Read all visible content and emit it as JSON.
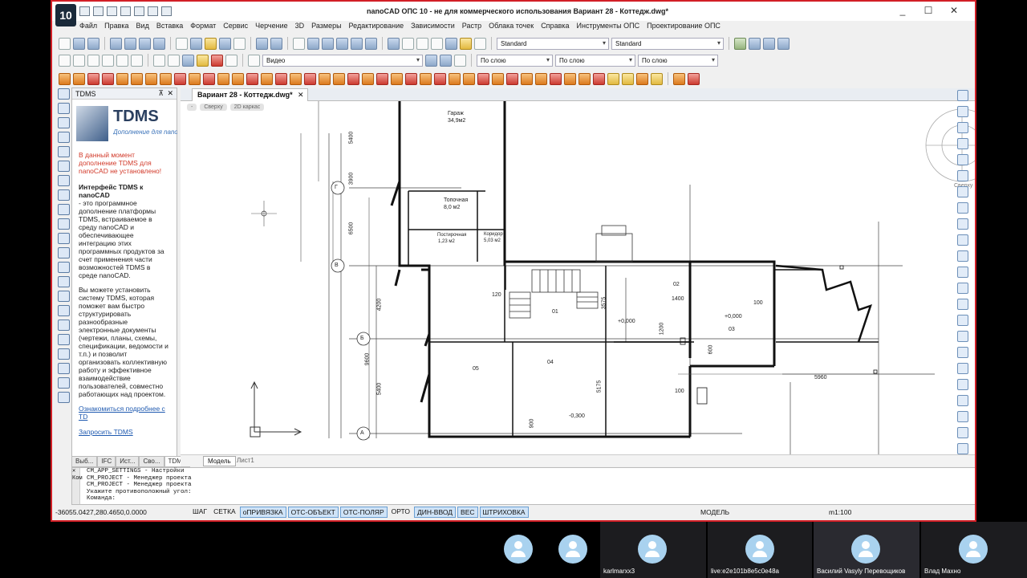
{
  "window": {
    "title": "nanoCAD ОПС 10 - не для коммерческого использования Вариант 28 - Коттедж.dwg*",
    "logo": "10",
    "controls": [
      "_",
      "☐",
      "✕"
    ]
  },
  "menu": [
    "Файл",
    "Правка",
    "Вид",
    "Вставка",
    "Формат",
    "Сервис",
    "Черчение",
    "3D",
    "Размеры",
    "Редактирование",
    "Зависимости",
    "Растр",
    "Облака точек",
    "Справка",
    "Инструменты ОПС",
    "Проектирование ОПС"
  ],
  "toolbar": {
    "text_style": "Standard",
    "dim_style": "Standard",
    "visual_style": "Видео",
    "color": "По слою",
    "linetype": "По слою",
    "lineweight": "По слою"
  },
  "tdms": {
    "panel_title": "TDMS",
    "logo_text": "TDMS",
    "logo_sub": "Дополнение для nano",
    "warning": "В данный момент дополнение TDMS для nanoCAD не установлено!",
    "intro_bold": "Интерфейс TDMS к nanoCAD",
    "intro": "- это программное дополнение платформы TDMS, встраиваемое в среду nanoCAD и обеспечивающее интеграцию этих программных продуктов за счет применения части возможностей TDMS в среде nanoCAD.",
    "body": "Вы можете установить систему TDMS, которая поможет вам быстро структурировать разнообразные электронные документы (чертежи, планы, схемы, спецификации, ведомости и т.п.) и позволит организовать коллективную работу и эффективное взаимодействие пользователей, совместно работающих над проектом.",
    "link_more": "Ознакомиться подробнее с TD",
    "link_request": "Запросить TDMS",
    "tabs": [
      "Выб...",
      "IFC",
      "Ист...",
      "Сво...",
      "TDMS"
    ]
  },
  "document": {
    "tab": "Вариант 28 - Коттедж.dwg*",
    "view_controls": [
      "-",
      "Сверху",
      "2D каркас"
    ],
    "layout_tabs": [
      "Модель",
      "Лист1"
    ],
    "viewcube_label": "Сверху"
  },
  "drawing": {
    "axis_labels": [
      "Г",
      "В",
      "Б",
      "А"
    ],
    "rooms": [
      {
        "name": "Гараж",
        "area": "34,9м2"
      },
      {
        "name": "Топочная",
        "area": "8,0 м2"
      },
      {
        "name": "Постирочная",
        "area": "1,23 м2"
      },
      {
        "name": "Коридор",
        "area": "5,03 м2"
      }
    ],
    "room_numbers": [
      "01",
      "02",
      "03",
      "04",
      "05"
    ],
    "levels": [
      "+0,000",
      "+0,000",
      "-0,300"
    ],
    "dimensions": [
      "5400",
      "3900",
      "6500",
      "4200",
      "9600",
      "5400",
      "3575",
      "5175",
      "1400",
      "1200",
      "5960",
      "120",
      "100",
      "100",
      "900",
      "600"
    ]
  },
  "command_line": {
    "side_labels": [
      "✕",
      "Ком"
    ],
    "lines": [
      "CM_APP_SETTINGS - Настройки",
      "CM_PROJECT - Менеджер проекта",
      "CM_PROJECT - Менеджер проекта",
      "Укажите противоположный угол:",
      "Команда:"
    ]
  },
  "status": {
    "coords": "-36055.0427,280.4650,0.0000",
    "buttons": [
      {
        "label": "ШАГ",
        "on": false
      },
      {
        "label": "СЕТКА",
        "on": false
      },
      {
        "label": "оПРИВЯЗКА",
        "on": true
      },
      {
        "label": "ОТС-ОБЪЕКТ",
        "on": true
      },
      {
        "label": "ОТС-ПОЛЯР",
        "on": true
      },
      {
        "label": "ОРТО",
        "on": false
      },
      {
        "label": "ДИН-ВВОД",
        "on": true
      },
      {
        "label": "ВЕС",
        "on": true
      },
      {
        "label": "ШТРИХОВКА",
        "on": true
      }
    ],
    "model": "МОДЕЛЬ",
    "scale": "m1:100"
  },
  "participants": [
    {
      "name": ""
    },
    {
      "name": ""
    },
    {
      "name": "karlmarxx3"
    },
    {
      "name": "live:e2e101b8e5c0e48a"
    },
    {
      "name": "Василий Vasyly Перевощиков"
    },
    {
      "name": "Влад Махно"
    }
  ],
  "colors": {
    "frame": "#d21f26",
    "link": "#1f5ab0",
    "warning": "#d23a2a"
  }
}
